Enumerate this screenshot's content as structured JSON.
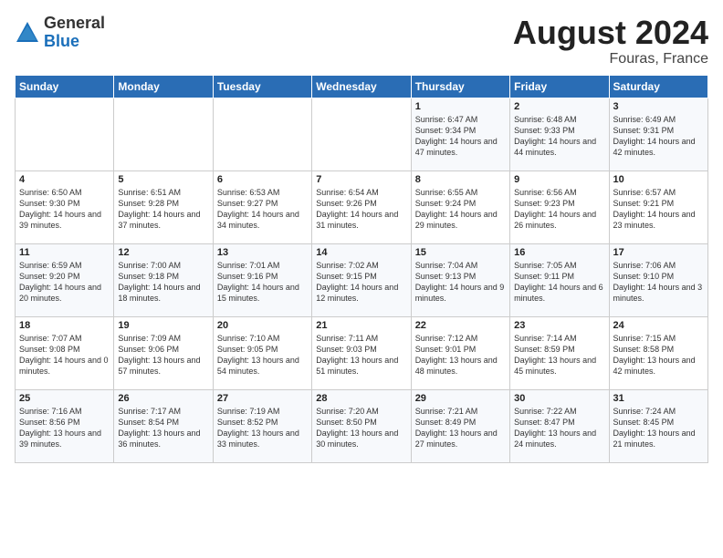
{
  "header": {
    "logo": {
      "general": "General",
      "blue": "Blue"
    },
    "title": "August 2024",
    "location": "Fouras, France"
  },
  "weekdays": [
    "Sunday",
    "Monday",
    "Tuesday",
    "Wednesday",
    "Thursday",
    "Friday",
    "Saturday"
  ],
  "weeks": [
    [
      {
        "day": "",
        "info": ""
      },
      {
        "day": "",
        "info": ""
      },
      {
        "day": "",
        "info": ""
      },
      {
        "day": "",
        "info": ""
      },
      {
        "day": "1",
        "info": "Sunrise: 6:47 AM\nSunset: 9:34 PM\nDaylight: 14 hours and 47 minutes."
      },
      {
        "day": "2",
        "info": "Sunrise: 6:48 AM\nSunset: 9:33 PM\nDaylight: 14 hours and 44 minutes."
      },
      {
        "day": "3",
        "info": "Sunrise: 6:49 AM\nSunset: 9:31 PM\nDaylight: 14 hours and 42 minutes."
      }
    ],
    [
      {
        "day": "4",
        "info": "Sunrise: 6:50 AM\nSunset: 9:30 PM\nDaylight: 14 hours and 39 minutes."
      },
      {
        "day": "5",
        "info": "Sunrise: 6:51 AM\nSunset: 9:28 PM\nDaylight: 14 hours and 37 minutes."
      },
      {
        "day": "6",
        "info": "Sunrise: 6:53 AM\nSunset: 9:27 PM\nDaylight: 14 hours and 34 minutes."
      },
      {
        "day": "7",
        "info": "Sunrise: 6:54 AM\nSunset: 9:26 PM\nDaylight: 14 hours and 31 minutes."
      },
      {
        "day": "8",
        "info": "Sunrise: 6:55 AM\nSunset: 9:24 PM\nDaylight: 14 hours and 29 minutes."
      },
      {
        "day": "9",
        "info": "Sunrise: 6:56 AM\nSunset: 9:23 PM\nDaylight: 14 hours and 26 minutes."
      },
      {
        "day": "10",
        "info": "Sunrise: 6:57 AM\nSunset: 9:21 PM\nDaylight: 14 hours and 23 minutes."
      }
    ],
    [
      {
        "day": "11",
        "info": "Sunrise: 6:59 AM\nSunset: 9:20 PM\nDaylight: 14 hours and 20 minutes."
      },
      {
        "day": "12",
        "info": "Sunrise: 7:00 AM\nSunset: 9:18 PM\nDaylight: 14 hours and 18 minutes."
      },
      {
        "day": "13",
        "info": "Sunrise: 7:01 AM\nSunset: 9:16 PM\nDaylight: 14 hours and 15 minutes."
      },
      {
        "day": "14",
        "info": "Sunrise: 7:02 AM\nSunset: 9:15 PM\nDaylight: 14 hours and 12 minutes."
      },
      {
        "day": "15",
        "info": "Sunrise: 7:04 AM\nSunset: 9:13 PM\nDaylight: 14 hours and 9 minutes."
      },
      {
        "day": "16",
        "info": "Sunrise: 7:05 AM\nSunset: 9:11 PM\nDaylight: 14 hours and 6 minutes."
      },
      {
        "day": "17",
        "info": "Sunrise: 7:06 AM\nSunset: 9:10 PM\nDaylight: 14 hours and 3 minutes."
      }
    ],
    [
      {
        "day": "18",
        "info": "Sunrise: 7:07 AM\nSunset: 9:08 PM\nDaylight: 14 hours and 0 minutes."
      },
      {
        "day": "19",
        "info": "Sunrise: 7:09 AM\nSunset: 9:06 PM\nDaylight: 13 hours and 57 minutes."
      },
      {
        "day": "20",
        "info": "Sunrise: 7:10 AM\nSunset: 9:05 PM\nDaylight: 13 hours and 54 minutes."
      },
      {
        "day": "21",
        "info": "Sunrise: 7:11 AM\nSunset: 9:03 PM\nDaylight: 13 hours and 51 minutes."
      },
      {
        "day": "22",
        "info": "Sunrise: 7:12 AM\nSunset: 9:01 PM\nDaylight: 13 hours and 48 minutes."
      },
      {
        "day": "23",
        "info": "Sunrise: 7:14 AM\nSunset: 8:59 PM\nDaylight: 13 hours and 45 minutes."
      },
      {
        "day": "24",
        "info": "Sunrise: 7:15 AM\nSunset: 8:58 PM\nDaylight: 13 hours and 42 minutes."
      }
    ],
    [
      {
        "day": "25",
        "info": "Sunrise: 7:16 AM\nSunset: 8:56 PM\nDaylight: 13 hours and 39 minutes."
      },
      {
        "day": "26",
        "info": "Sunrise: 7:17 AM\nSunset: 8:54 PM\nDaylight: 13 hours and 36 minutes."
      },
      {
        "day": "27",
        "info": "Sunrise: 7:19 AM\nSunset: 8:52 PM\nDaylight: 13 hours and 33 minutes."
      },
      {
        "day": "28",
        "info": "Sunrise: 7:20 AM\nSunset: 8:50 PM\nDaylight: 13 hours and 30 minutes."
      },
      {
        "day": "29",
        "info": "Sunrise: 7:21 AM\nSunset: 8:49 PM\nDaylight: 13 hours and 27 minutes."
      },
      {
        "day": "30",
        "info": "Sunrise: 7:22 AM\nSunset: 8:47 PM\nDaylight: 13 hours and 24 minutes."
      },
      {
        "day": "31",
        "info": "Sunrise: 7:24 AM\nSunset: 8:45 PM\nDaylight: 13 hours and 21 minutes."
      }
    ]
  ]
}
